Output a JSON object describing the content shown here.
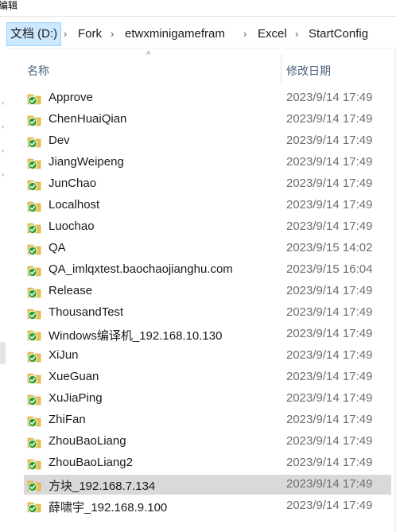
{
  "top_fragment": "编辑",
  "address": {
    "segments": [
      "文档 (D:)",
      "Fork",
      "etwxminigamefram",
      "Excel",
      "StartConfig"
    ]
  },
  "columns": {
    "name": "名称",
    "date": "修改日期",
    "sort_indicator": "^"
  },
  "files": [
    {
      "name": "Approve",
      "date": "2023/9/14 17:49"
    },
    {
      "name": "ChenHuaiQian",
      "date": "2023/9/14 17:49"
    },
    {
      "name": "Dev",
      "date": "2023/9/14 17:49"
    },
    {
      "name": "JiangWeipeng",
      "date": "2023/9/14 17:49"
    },
    {
      "name": "JunChao",
      "date": "2023/9/14 17:49"
    },
    {
      "name": "Localhost",
      "date": "2023/9/14 17:49"
    },
    {
      "name": "Luochao",
      "date": "2023/9/14 17:49"
    },
    {
      "name": "QA",
      "date": "2023/9/15 14:02"
    },
    {
      "name": "QA_imlqxtest.baochaojianghu.com",
      "date": "2023/9/15 16:04"
    },
    {
      "name": "Release",
      "date": "2023/9/14 17:49"
    },
    {
      "name": "ThousandTest",
      "date": "2023/9/14 17:49"
    },
    {
      "name": "Windows编译机_192.168.10.130",
      "date": "2023/9/14 17:49"
    },
    {
      "name": "XiJun",
      "date": "2023/9/14 17:49"
    },
    {
      "name": "XueGuan",
      "date": "2023/9/14 17:49"
    },
    {
      "name": "XuJiaPing",
      "date": "2023/9/14 17:49"
    },
    {
      "name": "ZhiFan",
      "date": "2023/9/14 17:49"
    },
    {
      "name": "ZhouBaoLiang",
      "date": "2023/9/14 17:49"
    },
    {
      "name": "ZhouBaoLiang2",
      "date": "2023/9/14 17:49"
    },
    {
      "name": "方块_192.168.7.134",
      "date": "2023/9/14 17:49",
      "selected": true
    },
    {
      "name": "薛啸宇_192.168.9.100",
      "date": "2023/9/14 17:49"
    }
  ],
  "colors": {
    "folder": "#e8c14b",
    "check_badge": "#2f9e2f",
    "selection": "#d9d9d9",
    "breadcrumb_active": "#cce8ff"
  },
  "icons": {
    "file_icon": "folder-sync-check-icon",
    "separator": "chevron-right-icon"
  }
}
